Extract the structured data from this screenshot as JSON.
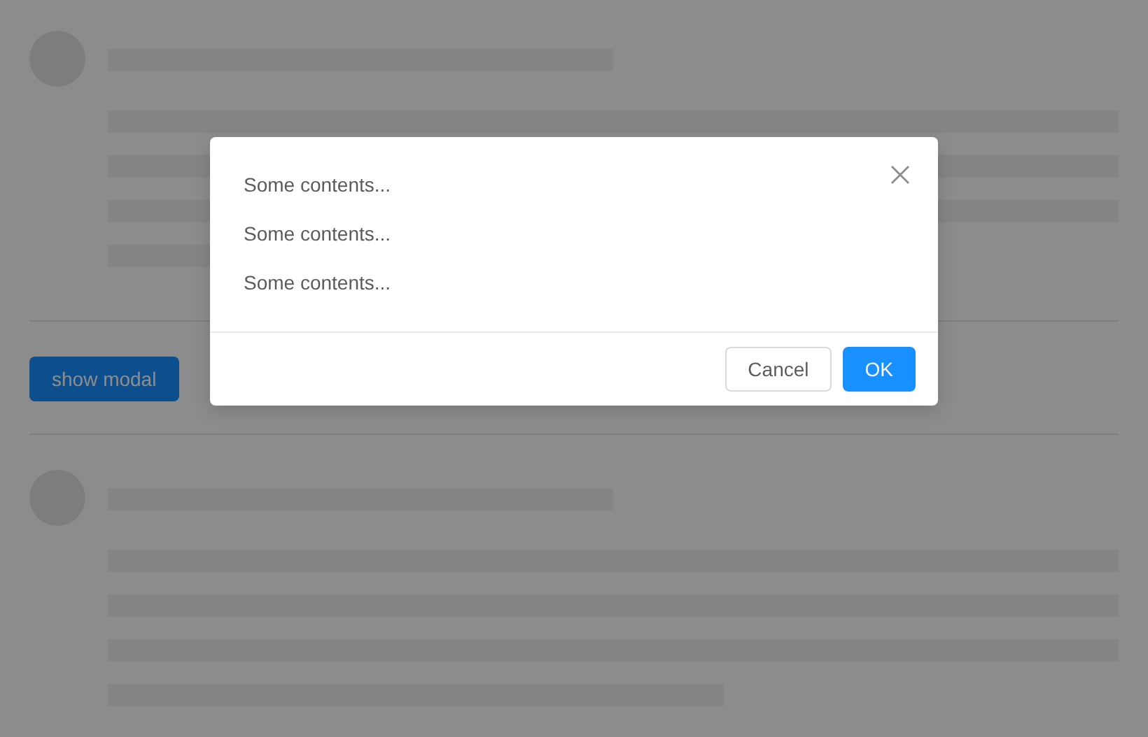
{
  "page": {
    "skeletons": [
      {
        "kind": "avatar-paragraph"
      },
      {
        "kind": "avatar-paragraph"
      }
    ],
    "button": {
      "label": "show modal"
    }
  },
  "modal": {
    "open": true,
    "contents": [
      "Some contents...",
      "Some contents...",
      "Some contents..."
    ],
    "buttons": [
      {
        "label": "Cancel",
        "kind": "default"
      },
      {
        "label": "OK",
        "kind": "primary"
      }
    ]
  }
}
